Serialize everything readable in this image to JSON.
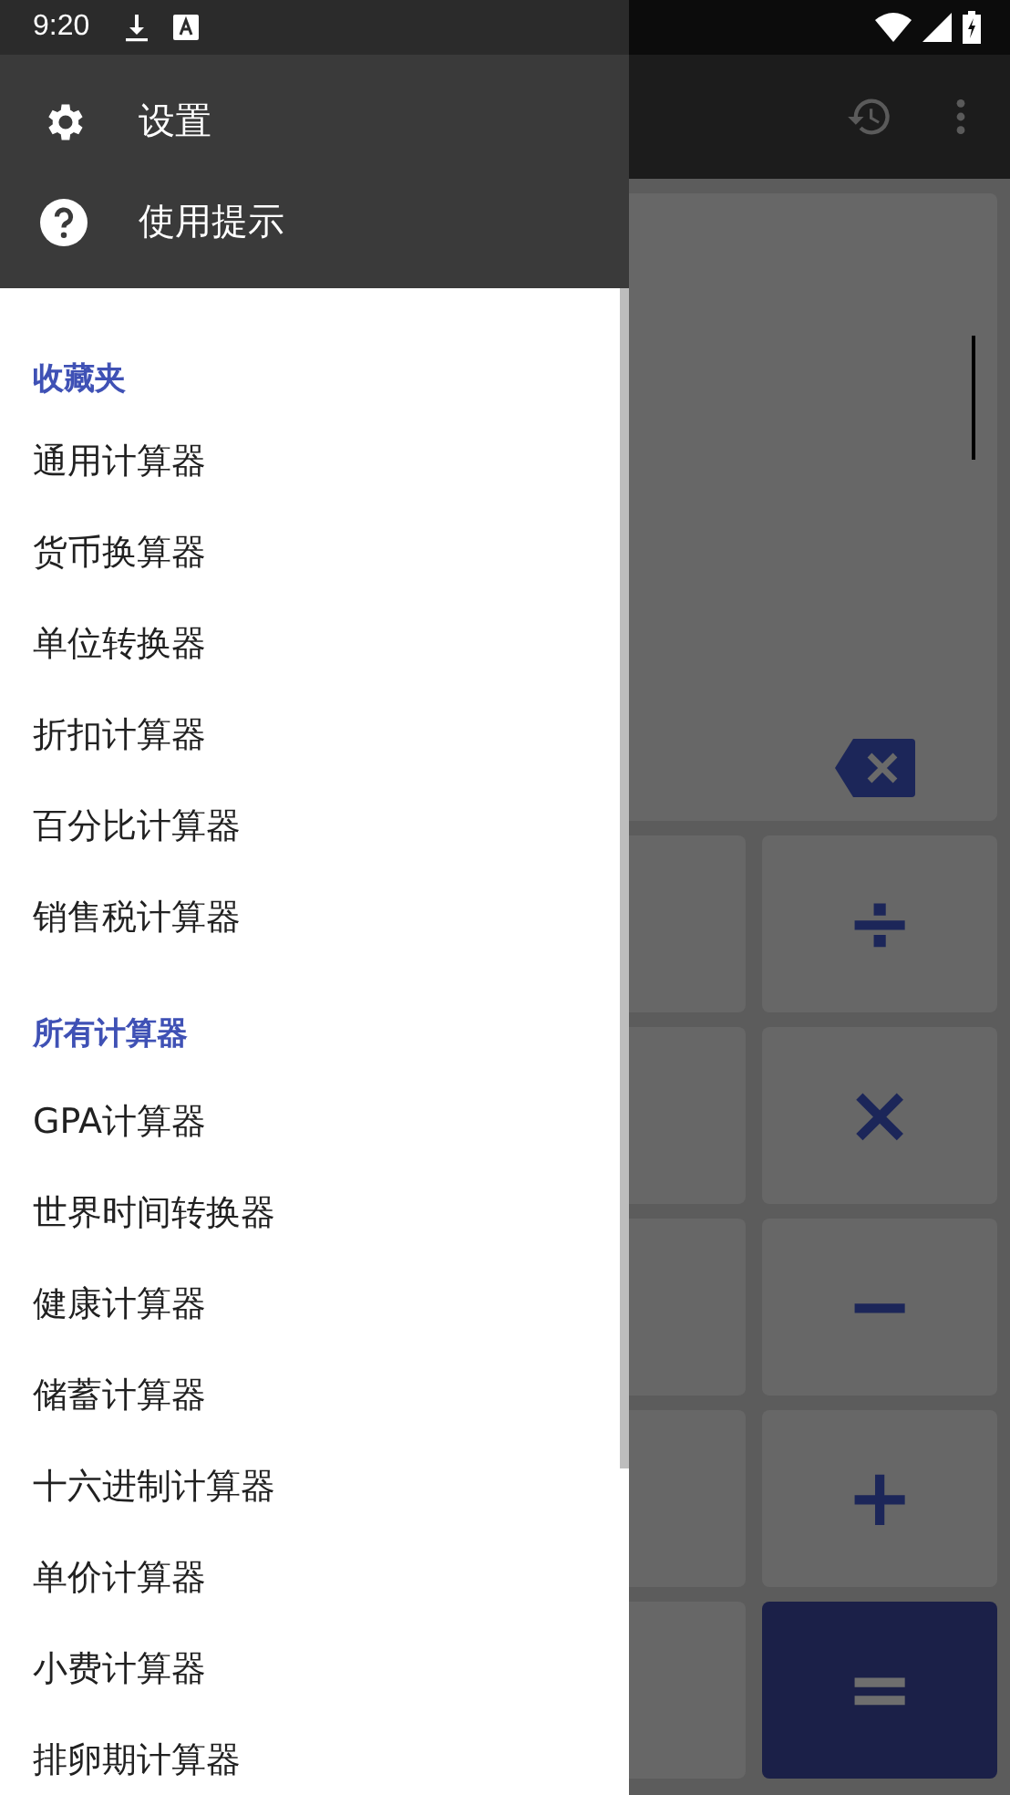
{
  "status_bar": {
    "time": "9:20"
  },
  "drawer": {
    "header_items": [
      {
        "label": "设置",
        "kind": "settings"
      },
      {
        "label": "使用提示",
        "kind": "help"
      }
    ],
    "sections": [
      {
        "title": "收藏夹",
        "items": [
          "通用计算器",
          "货币换算器",
          "单位转换器",
          "折扣计算器",
          "百分比计算器",
          "销售税计算器"
        ]
      },
      {
        "title": "所有计算器",
        "items": [
          "GPA计算器",
          "世界时间转换器",
          "健康计算器",
          "储蓄计算器",
          "十六进制计算器",
          "单价计算器",
          "小费计算器",
          "排卵期计算器"
        ]
      }
    ]
  },
  "calculator": {
    "operator_keys": [
      {
        "label": "÷",
        "kind": "operator"
      },
      {
        "label": "×",
        "kind": "operator"
      },
      {
        "label": "−",
        "kind": "operator"
      },
      {
        "label": "+",
        "kind": "operator"
      },
      {
        "label": "=",
        "kind": "equals"
      }
    ]
  }
}
